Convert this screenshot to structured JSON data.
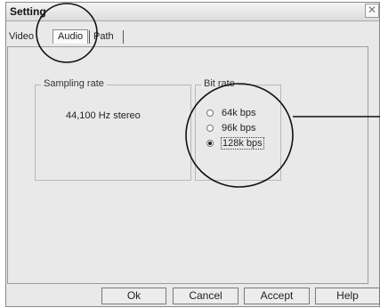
{
  "dialog": {
    "title": "Setting",
    "close_glyph": "✕"
  },
  "tabs": [
    {
      "label": "Video",
      "active": false
    },
    {
      "label": "Audio",
      "active": true
    },
    {
      "label": "Path",
      "active": false
    }
  ],
  "sampling": {
    "label": "Sampling rate",
    "value": "44,100 Hz stereo"
  },
  "bitrate": {
    "label": "Bit rate",
    "options": [
      {
        "label": "64k bps",
        "selected": false
      },
      {
        "label": "96k bps",
        "selected": false
      },
      {
        "label": "128k bps",
        "selected": true
      }
    ]
  },
  "buttons": {
    "ok": "Ok",
    "cancel": "Cancel",
    "accept": "Accept",
    "help": "Help"
  },
  "annotation_colors": {
    "stroke": "#111111"
  }
}
